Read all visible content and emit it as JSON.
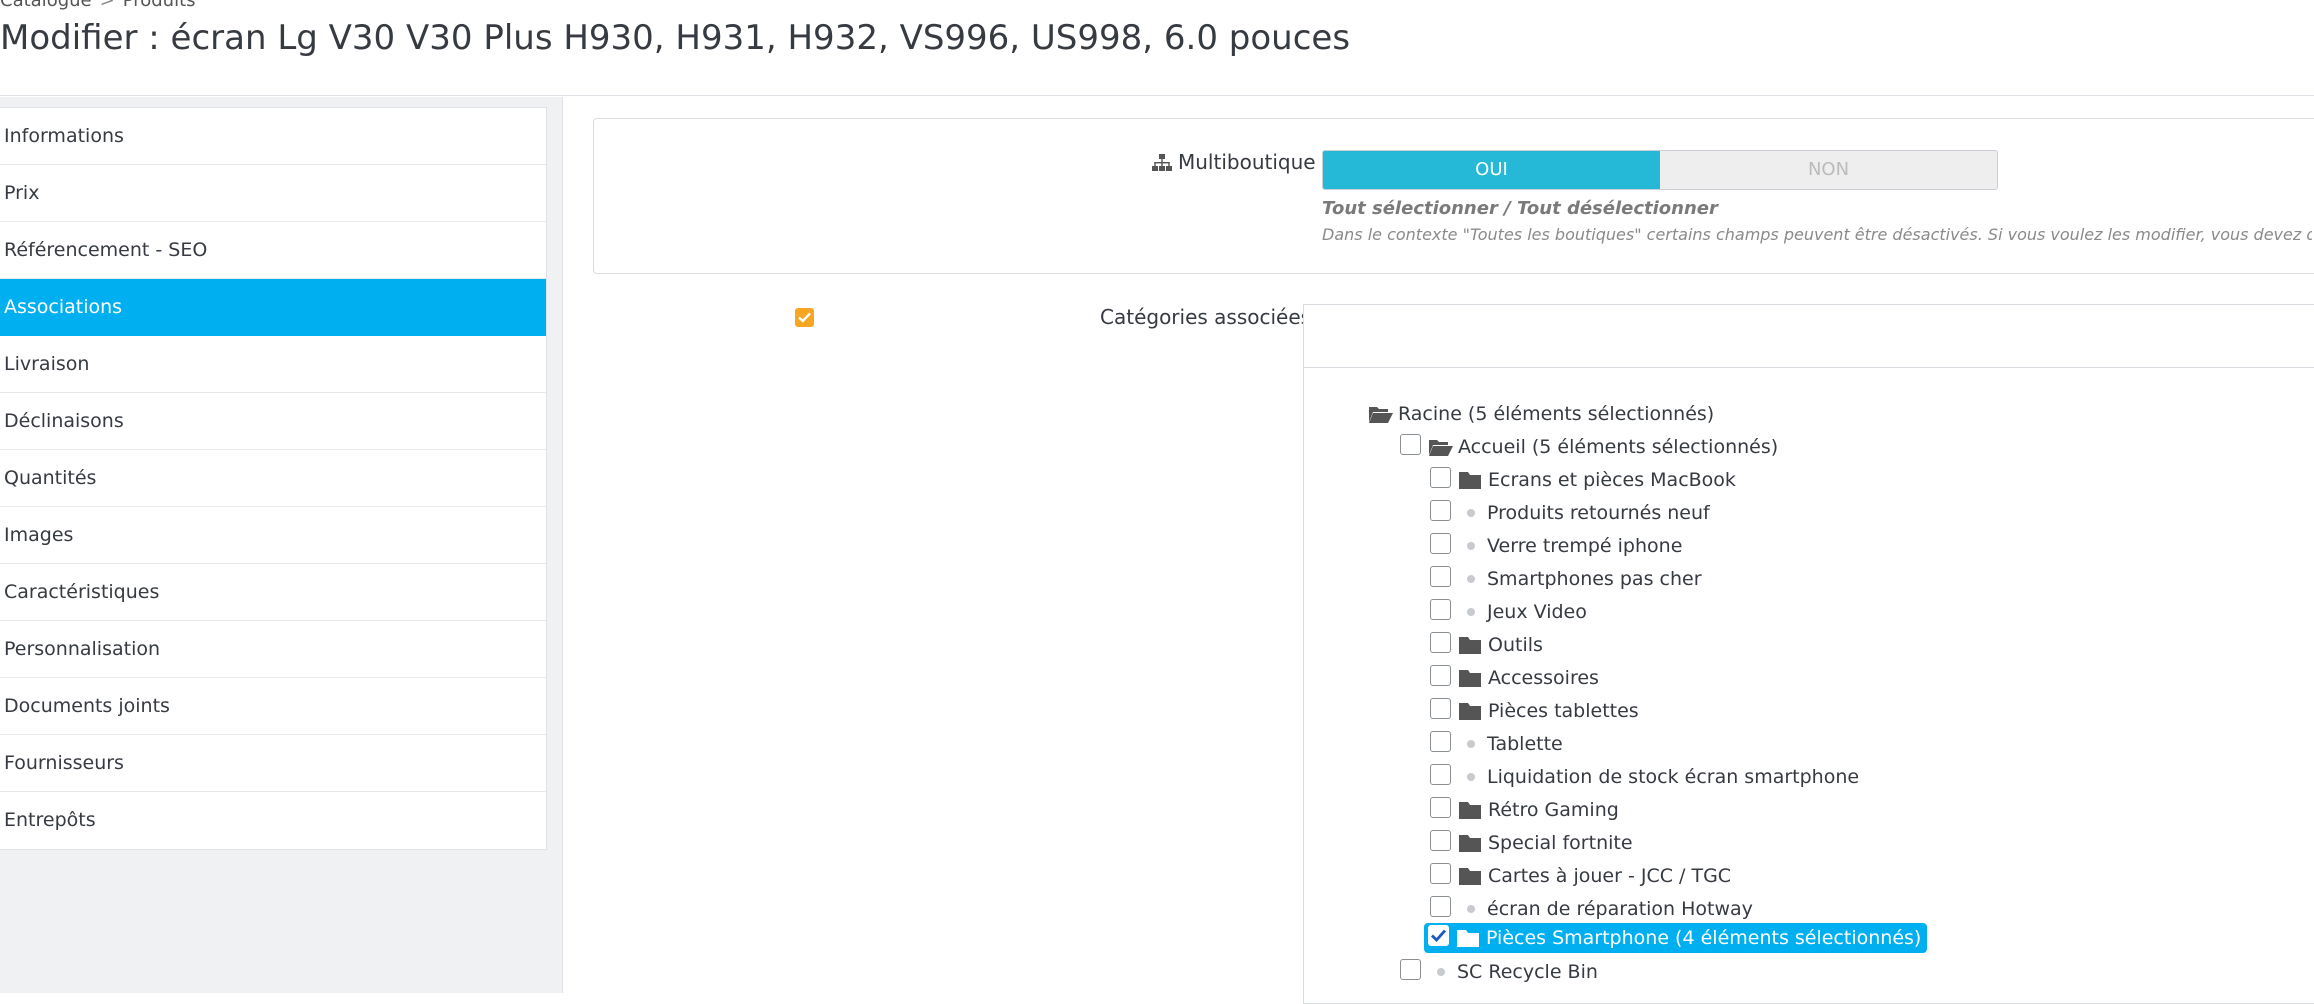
{
  "breadcrumb": {
    "items": [
      "Catalogue",
      "Produits"
    ],
    "separator": ">"
  },
  "page": {
    "title": "Modifier : écran Lg V30 V30 Plus H930, H931, H932, VS996, US998, 6.0 pouces"
  },
  "sidebar": {
    "items": [
      {
        "label": "Informations",
        "active": false
      },
      {
        "label": "Prix",
        "active": false
      },
      {
        "label": "Référencement - SEO",
        "active": false
      },
      {
        "label": "Associations",
        "active": true
      },
      {
        "label": "Livraison",
        "active": false
      },
      {
        "label": "Déclinaisons",
        "active": false
      },
      {
        "label": "Quantités",
        "active": false
      },
      {
        "label": "Images",
        "active": false
      },
      {
        "label": "Caractéristiques",
        "active": false
      },
      {
        "label": "Personnalisation",
        "active": false
      },
      {
        "label": "Documents joints",
        "active": false
      },
      {
        "label": "Fournisseurs",
        "active": false
      },
      {
        "label": "Entrepôts",
        "active": false
      }
    ]
  },
  "multishop": {
    "label": "Multiboutique",
    "icon": "sitemap-icon",
    "yes_label": "OUI",
    "no_label": "NON",
    "selected": "OUI",
    "select_all_text": "Tout sélectionner / Tout désélectionner",
    "context_note": "Dans le contexte \"Toutes les boutiques\" certains champs peuvent être désactivés. Si vous voulez les modifier, vous devez d'abo"
  },
  "categories": {
    "label": "Catégories associées",
    "tree": [
      {
        "label": "Racine (5 éléments sélectionnés)",
        "icon": "folder-open-icon",
        "checkbox": false,
        "checked": false
      },
      {
        "label": "Accueil (5 éléments sélectionnés)",
        "icon": "folder-open-icon",
        "checkbox": true,
        "checked": false
      },
      {
        "label": "Ecrans et pièces MacBook",
        "icon": "folder-icon",
        "checkbox": true,
        "checked": false
      },
      {
        "label": "Produits retournés neuf",
        "icon": "dot-icon",
        "checkbox": true,
        "checked": false
      },
      {
        "label": "Verre trempé iphone",
        "icon": "dot-icon",
        "checkbox": true,
        "checked": false
      },
      {
        "label": "Smartphones pas cher",
        "icon": "dot-icon",
        "checkbox": true,
        "checked": false
      },
      {
        "label": "Jeux Video",
        "icon": "dot-icon",
        "checkbox": true,
        "checked": false
      },
      {
        "label": "Outils",
        "icon": "folder-icon",
        "checkbox": true,
        "checked": false
      },
      {
        "label": "Accessoires",
        "icon": "folder-icon",
        "checkbox": true,
        "checked": false
      },
      {
        "label": "Pièces tablettes",
        "icon": "folder-icon",
        "checkbox": true,
        "checked": false
      },
      {
        "label": "Tablette",
        "icon": "dot-icon",
        "checkbox": true,
        "checked": false
      },
      {
        "label": "Liquidation de stock écran smartphone",
        "icon": "dot-icon",
        "checkbox": true,
        "checked": false
      },
      {
        "label": "Rétro Gaming",
        "icon": "folder-icon",
        "checkbox": true,
        "checked": false
      },
      {
        "label": "Special fortnite",
        "icon": "folder-icon",
        "checkbox": true,
        "checked": false
      },
      {
        "label": "Cartes à jouer - JCC / TGC",
        "icon": "folder-icon",
        "checkbox": true,
        "checked": false
      },
      {
        "label": "écran de réparation Hotway",
        "icon": "dot-icon",
        "checkbox": true,
        "checked": false
      },
      {
        "label": "Pièces Smartphone (4 éléments sélectionnés)",
        "icon": "folder-icon",
        "checkbox": true,
        "checked": true
      },
      {
        "label": "SC Recycle Bin",
        "icon": "dot-icon",
        "checkbox": true,
        "checked": false
      }
    ]
  },
  "colors": {
    "accent": "#00aff0",
    "toggle_on": "#25b9d7",
    "orange": "#f5a623"
  }
}
